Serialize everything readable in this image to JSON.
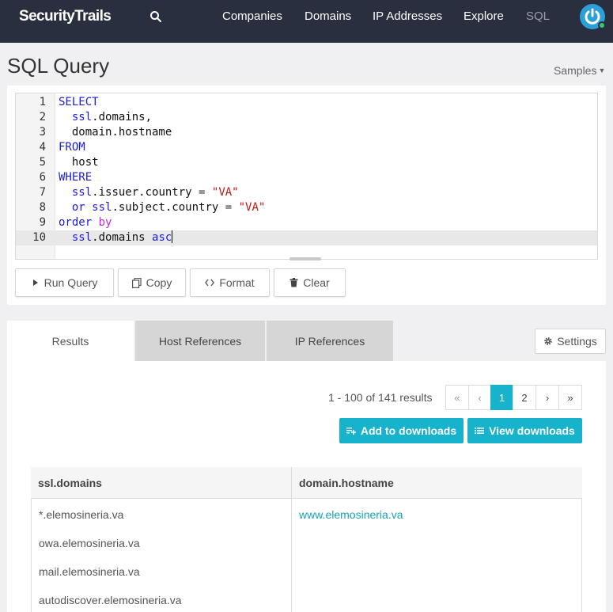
{
  "nav": {
    "logo": "SecurityTrails",
    "items": [
      "Companies",
      "Domains",
      "IP Addresses",
      "Explore",
      "SQL"
    ]
  },
  "page": {
    "title": "SQL Query",
    "samples_label": "Samples"
  },
  "editor": {
    "line_numbers": [
      "1",
      "2",
      "3",
      "4",
      "5",
      "6",
      "7",
      "8",
      "9",
      "10"
    ]
  },
  "toolbar": {
    "run": "Run Query",
    "copy": "Copy",
    "format": "Format",
    "clear": "Clear"
  },
  "tabs": {
    "results": "Results",
    "host_refs": "Host References",
    "ip_refs": "IP References",
    "settings": "Settings"
  },
  "results": {
    "count": "1 - 100 of 141 results",
    "pager": {
      "first": "«",
      "prev": "‹",
      "page1": "1",
      "page2": "2",
      "next": "›",
      "last": "»"
    },
    "add_downloads": "Add to downloads",
    "view_downloads": "View downloads"
  },
  "table": {
    "headers": [
      "ssl.domains",
      "domain.hostname"
    ],
    "ssl_domains": [
      "*.elemosineria.va",
      "owa.elemosineria.va",
      "mail.elemosineria.va",
      "autodiscover.elemosineria.va"
    ],
    "hostname": "www.elemosineria.va"
  },
  "colors": {
    "nav_bg": "#2a2f3f",
    "accent": "#17b2cc",
    "keyword": "#1b1bd6",
    "string": "#c41a16"
  }
}
